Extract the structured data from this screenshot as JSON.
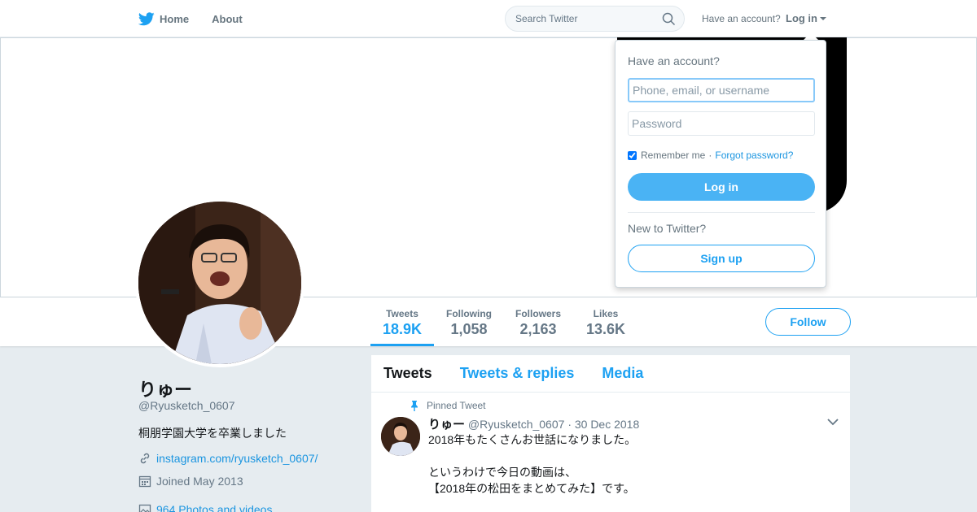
{
  "nav": {
    "home_label": "Home",
    "about_label": "About",
    "search_placeholder": "Search Twitter",
    "have_account": "Have an account?",
    "login_label": "Log in"
  },
  "colors": {
    "accent": "#1da1f2",
    "banner_shape": "#000000"
  },
  "stats": [
    {
      "label": "Tweets",
      "value": "18.9K"
    },
    {
      "label": "Following",
      "value": "1,058"
    },
    {
      "label": "Followers",
      "value": "2,163"
    },
    {
      "label": "Likes",
      "value": "13.6K"
    }
  ],
  "follow_label": "Follow",
  "profile": {
    "name": "りゅー",
    "handle": "@Ryusketch_0607",
    "bio": "桐朋学園大学を卒業しました",
    "link": "instagram.com/ryusketch_0607/",
    "joined": "Joined May 2013",
    "photos": "964 Photos and videos"
  },
  "timeline": {
    "tabs": [
      "Tweets",
      "Tweets & replies",
      "Media"
    ],
    "pinned_label": "Pinned Tweet",
    "tweet": {
      "name": "りゅー",
      "handle": "@Ryusketch_0607",
      "date": "· 30 Dec 2018",
      "lines": [
        "2018年もたくさんお世話になりました。",
        "",
        "というわけで今日の動画は、",
        "【2018年の松田をまとめてみた】です。"
      ]
    }
  },
  "login_dropdown": {
    "title": "Have an account?",
    "username_placeholder": "Phone, email, or username",
    "password_placeholder": "Password",
    "remember_label": "Remember me",
    "separator": "·",
    "forgot_label": "Forgot password?",
    "login_button": "Log in",
    "new_label": "New to Twitter?",
    "signup_button": "Sign up"
  }
}
